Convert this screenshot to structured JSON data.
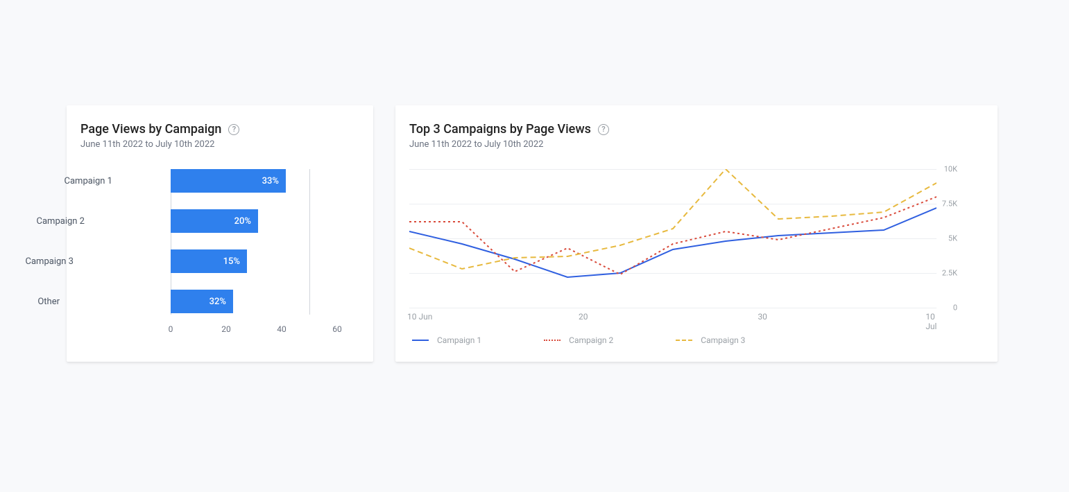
{
  "left_card": {
    "title": "Page Views by Campaign",
    "subtitle": "June 11th 2022 to July 10th 2022"
  },
  "right_card": {
    "title": "Top 3 Campaigns by Page Views",
    "subtitle": "June 11th 2022 to July 10th 2022"
  },
  "legend": {
    "c1": "Campaign 1",
    "c2": "Campaign 2",
    "c3": "Campaign 3"
  },
  "bar_xticks": [
    "0",
    "20",
    "40",
    "60"
  ],
  "bar_labels": {
    "c1": "Campaign 1",
    "c2": "Campaign 2",
    "c3": "Campaign 3",
    "other": "Other"
  },
  "bar_values": {
    "c1": "33%",
    "c2": "20%",
    "c3": "15%",
    "other": "32%"
  },
  "line_yticks": [
    "0",
    "2.5K",
    "5K",
    "7.5K",
    "10K"
  ],
  "line_xticks": [
    "10 Jun",
    "20",
    "30",
    "10 Jul"
  ],
  "colors": {
    "bar": "#2f80ed",
    "c1": "#2f5fe0",
    "c2": "#d94a3a",
    "c3": "#e7b93e"
  },
  "chart_data": [
    {
      "type": "bar",
      "orientation": "horizontal",
      "title": "Page Views by Campaign",
      "subtitle": "June 11th 2022 to July 10th 2022",
      "categories": [
        "Campaign 1",
        "Campaign 2",
        "Campaign 3",
        "Other"
      ],
      "values": [
        33,
        20,
        15,
        32
      ],
      "value_suffix": "%",
      "xlabel": "",
      "ylabel": "",
      "xlim": [
        0,
        60
      ],
      "xticks": [
        0,
        20,
        40,
        60
      ],
      "bar_color": "#2f80ed"
    },
    {
      "type": "line",
      "title": "Top 3 Campaigns by Page Views",
      "subtitle": "June 11th 2022 to July 10th 2022",
      "x": [
        10,
        13,
        16,
        19,
        22,
        25,
        28,
        31,
        34,
        37,
        40
      ],
      "x_tick_labels": [
        "10 Jun",
        "20",
        "30",
        "10 Jul"
      ],
      "series": [
        {
          "name": "Campaign 1",
          "color": "#2f5fe0",
          "dash": "solid",
          "values": [
            5500,
            4600,
            3500,
            2200,
            2500,
            4200,
            4800,
            5200,
            5400,
            5600,
            7200
          ]
        },
        {
          "name": "Campaign 2",
          "color": "#d94a3a",
          "dash": "dotted",
          "values": [
            6200,
            6200,
            2600,
            4300,
            2400,
            4600,
            5500,
            4900,
            5700,
            6500,
            8000
          ]
        },
        {
          "name": "Campaign 3",
          "color": "#e7b93e",
          "dash": "dashed",
          "values": [
            4300,
            2800,
            3600,
            3700,
            4500,
            5700,
            10000,
            6400,
            6600,
            6900,
            9000
          ]
        }
      ],
      "ylim": [
        0,
        10000
      ],
      "yticks": [
        0,
        2500,
        5000,
        7500,
        10000
      ],
      "ytick_labels": [
        "0",
        "2.5K",
        "5K",
        "7.5K",
        "10K"
      ],
      "legend_position": "bottom"
    }
  ]
}
